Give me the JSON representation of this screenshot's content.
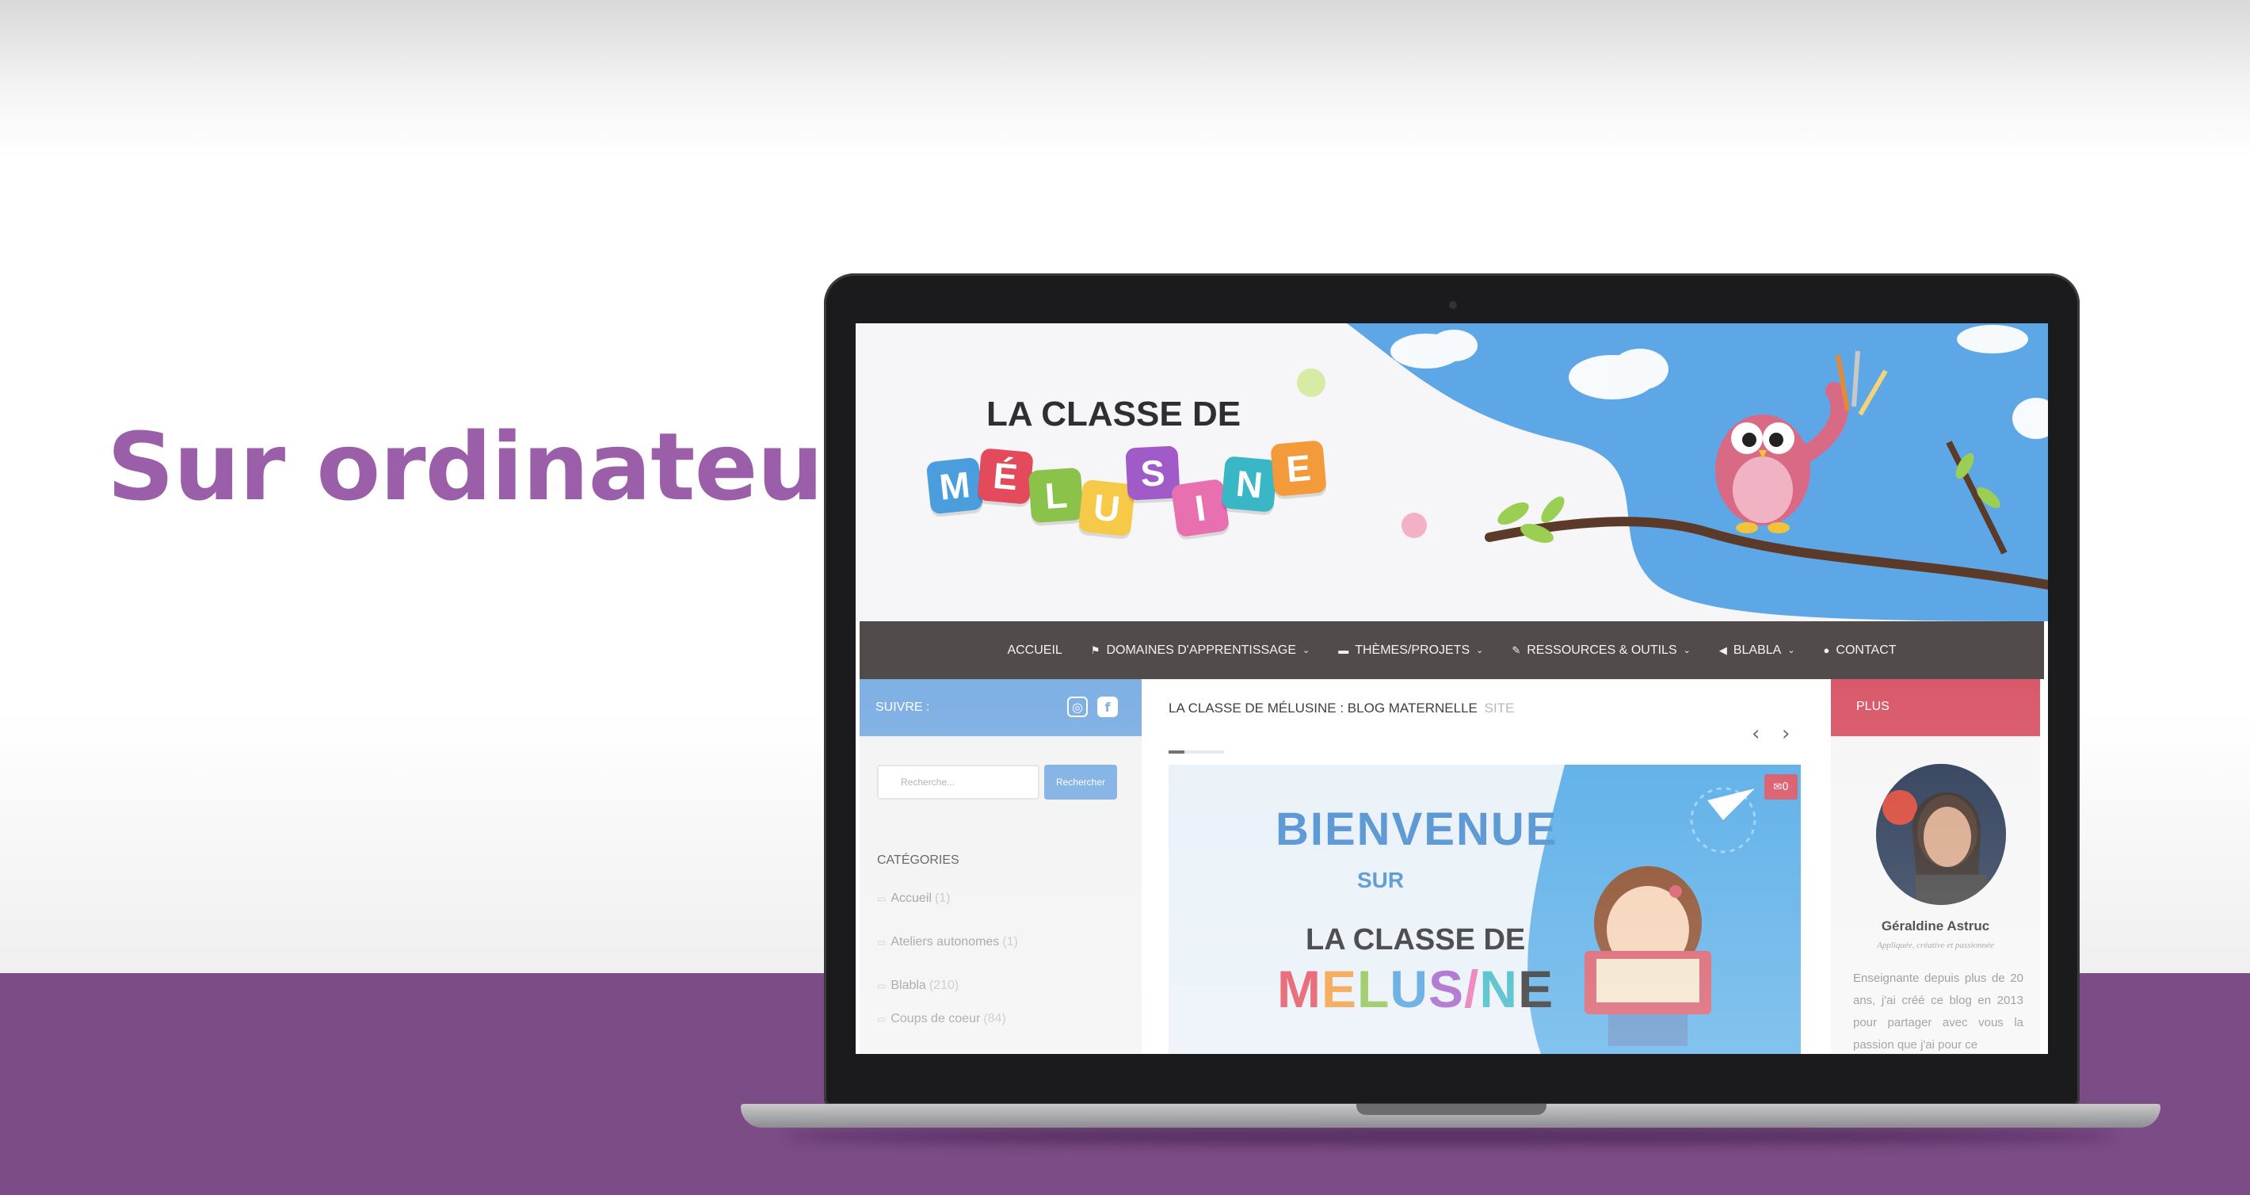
{
  "headline": "Sur ordinateur",
  "colors": {
    "accent_purple": "#9a5fa8",
    "band_purple": "#7b4c86",
    "follow_blue": "#7fb0e4",
    "plus_red": "#d9596a",
    "nav_bg": "#514c4b"
  },
  "site": {
    "logo": {
      "line1": "LA CLASSE DE",
      "letters": [
        "M",
        "É",
        "L",
        "U",
        "S",
        "I",
        "N",
        "E"
      ]
    },
    "nav": [
      {
        "label": "ACCUEIL",
        "icon": "",
        "dropdown": false
      },
      {
        "label": "DOMAINES D'APPRENTISSAGE",
        "icon": "flag-icon",
        "dropdown": true
      },
      {
        "label": "THÈMES/PROJETS",
        "icon": "folder-icon",
        "dropdown": true
      },
      {
        "label": "RESSOURCES & OUTILS",
        "icon": "wrench-icon",
        "dropdown": true
      },
      {
        "label": "BLABLA",
        "icon": "megaphone-icon",
        "dropdown": true
      },
      {
        "label": "CONTACT",
        "icon": "user-icon",
        "dropdown": false
      }
    ],
    "sidebar_left": {
      "follow_label": "SUIVRE :",
      "social_icons": [
        "instagram-icon",
        "facebook-icon"
      ],
      "search_placeholder": "Recherche...",
      "search_button": "Rechercher",
      "categories_title": "CATÉGORIES",
      "categories": [
        {
          "name": "Accueil",
          "count": "(1)"
        },
        {
          "name": "Ateliers autonomes",
          "count": "(1)"
        },
        {
          "name": "Blabla",
          "count": "(210)"
        },
        {
          "name": "Coups de coeur",
          "count": "(84)"
        }
      ]
    },
    "main": {
      "heading": "LA CLASSE DE MÉLUSINE : BLOG MATERNELLE",
      "heading_suffix": "SITE",
      "comment_count": "0",
      "slide": {
        "line1": "BIENVENUE",
        "line2": "SUR",
        "line3": "LA CLASSE DE",
        "line4_letters": [
          "M",
          "E",
          "L",
          "U",
          "S",
          "/",
          "N",
          "E"
        ]
      }
    },
    "sidebar_right": {
      "title": "PLUS",
      "author_name": "Géraldine Astruc",
      "author_tagline": "Appliquée, créative et passionnée",
      "author_bio": "Enseignante depuis plus de 20 ans, j'ai créé ce blog en 2013 pour partager avec vous la passion que j'ai pour ce"
    }
  }
}
